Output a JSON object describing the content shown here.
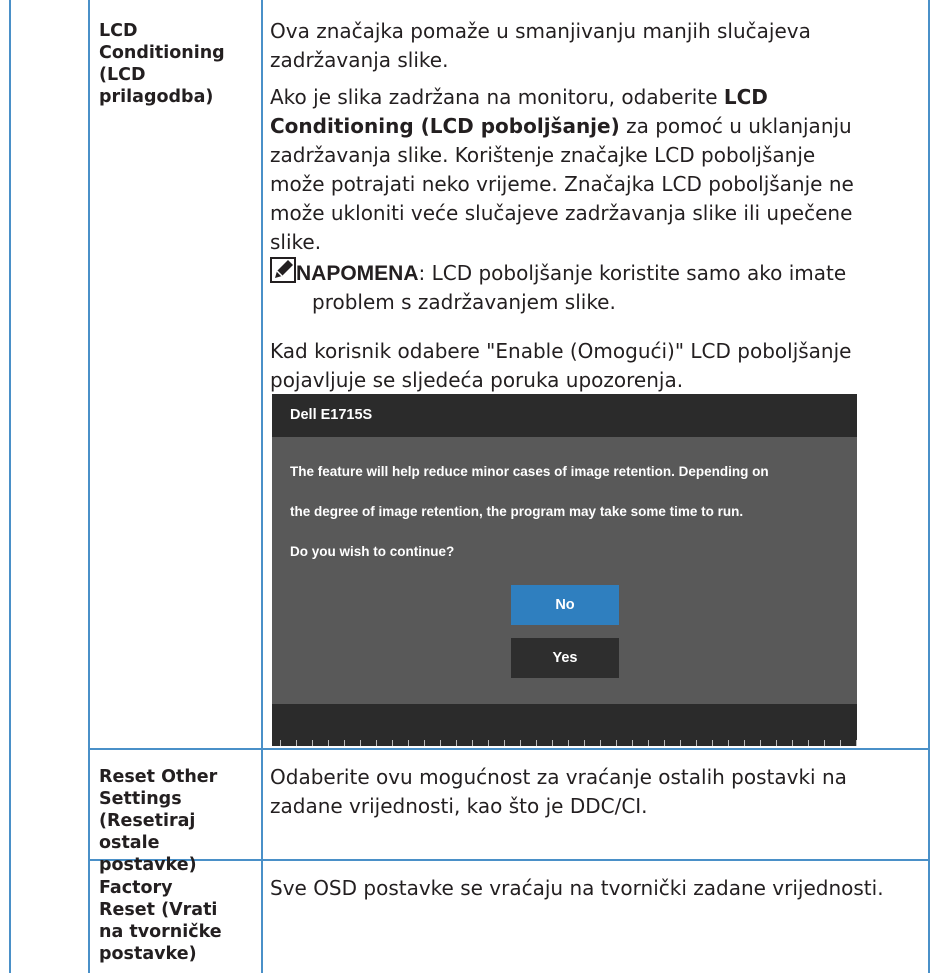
{
  "rows": [
    {
      "label_lines": [
        "LCD",
        "Conditioning",
        "(LCD",
        "prilagodba)"
      ],
      "paragraphs": {
        "p1_lines": [
          "Ova značajka pomaže u smanjivanju manjih slučajeva",
          "zadržavanja slike."
        ],
        "p2_line1_pre": "Ako je slika zadržana na monitoru, odaberite ",
        "p2_line1_bold": "LCD",
        "p2_line2_bold": "Conditioning (LCD poboljšanje)",
        "p2_line2_post": " za pomoć u uklanjanju",
        "p2_rest_lines": [
          "zadržavanja slike. Korištenje značajke LCD poboljšanje",
          "može potrajati neko vrijeme. Značajka LCD poboljšanje ne",
          "može ukloniti veće slučajeve zadržavanja slike ili upečene",
          "slike."
        ],
        "note_label": "NAPOMENA",
        "note_line1": ": LCD poboljšanje koristite samo ako imate",
        "note_line2": "problem s zadržavanjem slike.",
        "p3_lines": [
          "Kad korisnik odabere \"Enable (Omogući)\" LCD poboljšanje",
          "pojavljuje se sljedeća poruka upozorenja."
        ]
      }
    },
    {
      "label_lines": [
        "Reset Other",
        "Settings",
        "(Resetiraj ostale",
        "postavke)"
      ],
      "desc_lines": [
        "Odaberite ovu mogućnost za vraćanje ostalih postavki na",
        "zadane vrijednosti, kao što je DDC/CI."
      ]
    },
    {
      "label_lines": [
        "Factory",
        "Reset (Vrati",
        "na tvorničke",
        "postavke)"
      ],
      "desc_lines": [
        "Sve OSD postavke se vraćaju na tvornički zadane vrijednosti."
      ]
    }
  ],
  "osd": {
    "title": "Dell E1715S",
    "message_lines": [
      "The feature will help reduce minor cases of image retention. Depending on",
      "the degree of image retention, the program may take some time to run.",
      "Do you wish to continue?"
    ],
    "no_label": "No",
    "yes_label": "Yes"
  },
  "colors": {
    "grid": "#4a90c8",
    "osd_bg": "#595959",
    "osd_bar": "#2b2b2b",
    "osd_selected": "#2f7fbf"
  },
  "icons": {
    "note": "pencil-note-icon"
  }
}
